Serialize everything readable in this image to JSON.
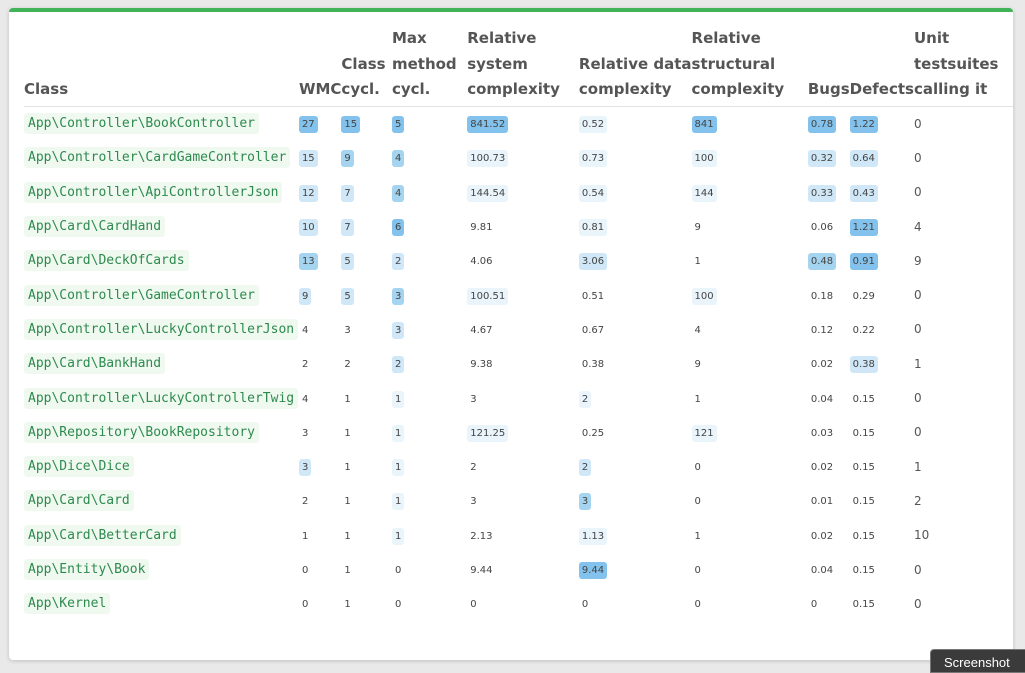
{
  "headers": {
    "class": "Class",
    "wmc": "WMC",
    "class_cycl_1": "Class",
    "class_cycl_2": "cycl.",
    "max_method_1": "Max",
    "max_method_2": "method",
    "max_method_3": "cycl.",
    "rel_sys_1": "Relative",
    "rel_sys_2": "system",
    "rel_sys_3": "complexity",
    "rel_data_1": "Relative data",
    "rel_data_2": "complexity",
    "rel_struct_1": "Relative",
    "rel_struct_2": "structural",
    "rel_struct_3": "complexity",
    "bugs": "Bugs",
    "defects": "Defects",
    "unit_1": "Unit",
    "unit_2": "testsuites",
    "unit_3": "calling it"
  },
  "rows": [
    {
      "class": "App\\Controller\\BookController",
      "wmc": "27",
      "cycl": "15",
      "maxm": "5",
      "sys": "841.52",
      "data": "0.52",
      "struct": "841",
      "bugs": "0.78",
      "defects": "1.22",
      "units": "0"
    },
    {
      "class": "App\\Controller\\CardGameController",
      "wmc": "15",
      "cycl": "9",
      "maxm": "4",
      "sys": "100.73",
      "data": "0.73",
      "struct": "100",
      "bugs": "0.32",
      "defects": "0.64",
      "units": "0"
    },
    {
      "class": "App\\Controller\\ApiControllerJson",
      "wmc": "12",
      "cycl": "7",
      "maxm": "4",
      "sys": "144.54",
      "data": "0.54",
      "struct": "144",
      "bugs": "0.33",
      "defects": "0.43",
      "units": "0"
    },
    {
      "class": "App\\Card\\CardHand",
      "wmc": "10",
      "cycl": "7",
      "maxm": "6",
      "sys": "9.81",
      "data": "0.81",
      "struct": "9",
      "bugs": "0.06",
      "defects": "1.21",
      "units": "4"
    },
    {
      "class": "App\\Card\\DeckOfCards",
      "wmc": "13",
      "cycl": "5",
      "maxm": "2",
      "sys": "4.06",
      "data": "3.06",
      "struct": "1",
      "bugs": "0.48",
      "defects": "0.91",
      "units": "9"
    },
    {
      "class": "App\\Controller\\GameController",
      "wmc": "9",
      "cycl": "5",
      "maxm": "3",
      "sys": "100.51",
      "data": "0.51",
      "struct": "100",
      "bugs": "0.18",
      "defects": "0.29",
      "units": "0"
    },
    {
      "class": "App\\Controller\\LuckyControllerJson",
      "wmc": "4",
      "cycl": "3",
      "maxm": "3",
      "sys": "4.67",
      "data": "0.67",
      "struct": "4",
      "bugs": "0.12",
      "defects": "0.22",
      "units": "0"
    },
    {
      "class": "App\\Card\\BankHand",
      "wmc": "2",
      "cycl": "2",
      "maxm": "2",
      "sys": "9.38",
      "data": "0.38",
      "struct": "9",
      "bugs": "0.02",
      "defects": "0.38",
      "units": "1"
    },
    {
      "class": "App\\Controller\\LuckyControllerTwig",
      "wmc": "4",
      "cycl": "1",
      "maxm": "1",
      "sys": "3",
      "data": "2",
      "struct": "1",
      "bugs": "0.04",
      "defects": "0.15",
      "units": "0"
    },
    {
      "class": "App\\Repository\\BookRepository",
      "wmc": "3",
      "cycl": "1",
      "maxm": "1",
      "sys": "121.25",
      "data": "0.25",
      "struct": "121",
      "bugs": "0.03",
      "defects": "0.15",
      "units": "0"
    },
    {
      "class": "App\\Dice\\Dice",
      "wmc": "3",
      "cycl": "1",
      "maxm": "1",
      "sys": "2",
      "data": "2",
      "struct": "0",
      "bugs": "0.02",
      "defects": "0.15",
      "units": "1"
    },
    {
      "class": "App\\Card\\Card",
      "wmc": "2",
      "cycl": "1",
      "maxm": "1",
      "sys": "3",
      "data": "3",
      "struct": "0",
      "bugs": "0.01",
      "defects": "0.15",
      "units": "2"
    },
    {
      "class": "App\\Card\\BetterCard",
      "wmc": "1",
      "cycl": "1",
      "maxm": "1",
      "sys": "2.13",
      "data": "1.13",
      "struct": "1",
      "bugs": "0.02",
      "defects": "0.15",
      "units": "10"
    },
    {
      "class": "App\\Entity\\Book",
      "wmc": "0",
      "cycl": "1",
      "maxm": "0",
      "sys": "9.44",
      "data": "9.44",
      "struct": "0",
      "bugs": "0.04",
      "defects": "0.15",
      "units": "0"
    },
    {
      "class": "App\\Kernel",
      "wmc": "0",
      "cycl": "1",
      "maxm": "0",
      "sys": "0",
      "data": "0",
      "struct": "0",
      "bugs": "0",
      "defects": "0.15",
      "units": "0"
    }
  ],
  "screenshot_button": "Screenshot",
  "colors": {
    "accent_top_border": "#41b45a",
    "class_text": "#2d8a4e",
    "class_bg": "#f0f9f0",
    "badge_levels": [
      "transparent",
      "#e9f4fb",
      "#cfe7f6",
      "#a5d4f0",
      "#82c2ec"
    ]
  }
}
